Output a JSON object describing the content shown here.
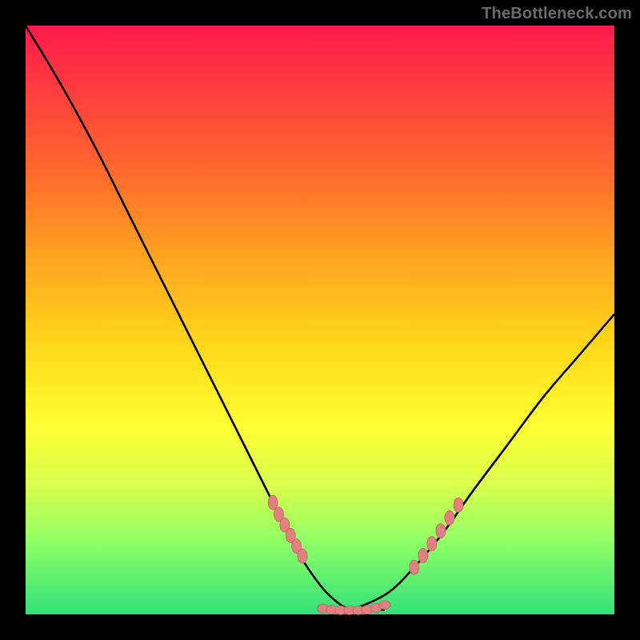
{
  "watermark": "TheBottleneck.com",
  "colors": {
    "page_bg": "#000000",
    "gradient_top": "#ff1a4d",
    "gradient_bottom": "#33e07a",
    "curve": "#000000",
    "marker_fill": "#e08080",
    "marker_stroke": "#c86060"
  },
  "chart_data": {
    "type": "line",
    "title": "",
    "xlabel": "",
    "ylabel": "",
    "xlim": [
      0,
      100
    ],
    "ylim": [
      0,
      100
    ],
    "curve_left": {
      "x": [
        0,
        6,
        12,
        18,
        24,
        30,
        36,
        42,
        46,
        50,
        53,
        55
      ],
      "y": [
        100,
        90,
        79,
        67,
        55,
        43,
        31,
        19,
        11,
        5,
        2,
        0.8
      ]
    },
    "curve_right": {
      "x": [
        55,
        58,
        62,
        66,
        71,
        76,
        82,
        88,
        94,
        100
      ],
      "y": [
        0.8,
        1.8,
        4,
        8,
        14,
        21,
        29,
        37,
        44,
        51
      ]
    },
    "bottom_flat": {
      "x": [
        50.5,
        61
      ],
      "y": [
        0.8,
        0.8
      ]
    },
    "markers_bottom": {
      "x": [
        50.5,
        52,
        53.5,
        55,
        56.5,
        58,
        59.5,
        61
      ],
      "y": [
        1.0,
        0.8,
        0.7,
        0.7,
        0.7,
        0.8,
        1.1,
        1.6
      ]
    },
    "markers_left_cluster": {
      "x": [
        42,
        43,
        44,
        45,
        46,
        47
      ],
      "y": [
        19,
        17,
        15.2,
        13.4,
        11.6,
        9.9
      ]
    },
    "markers_right_cluster": {
      "x": [
        66,
        67.5,
        69,
        70.5,
        72,
        73.5
      ],
      "y": [
        8,
        10,
        12,
        14.2,
        16.4,
        18.6
      ]
    }
  }
}
